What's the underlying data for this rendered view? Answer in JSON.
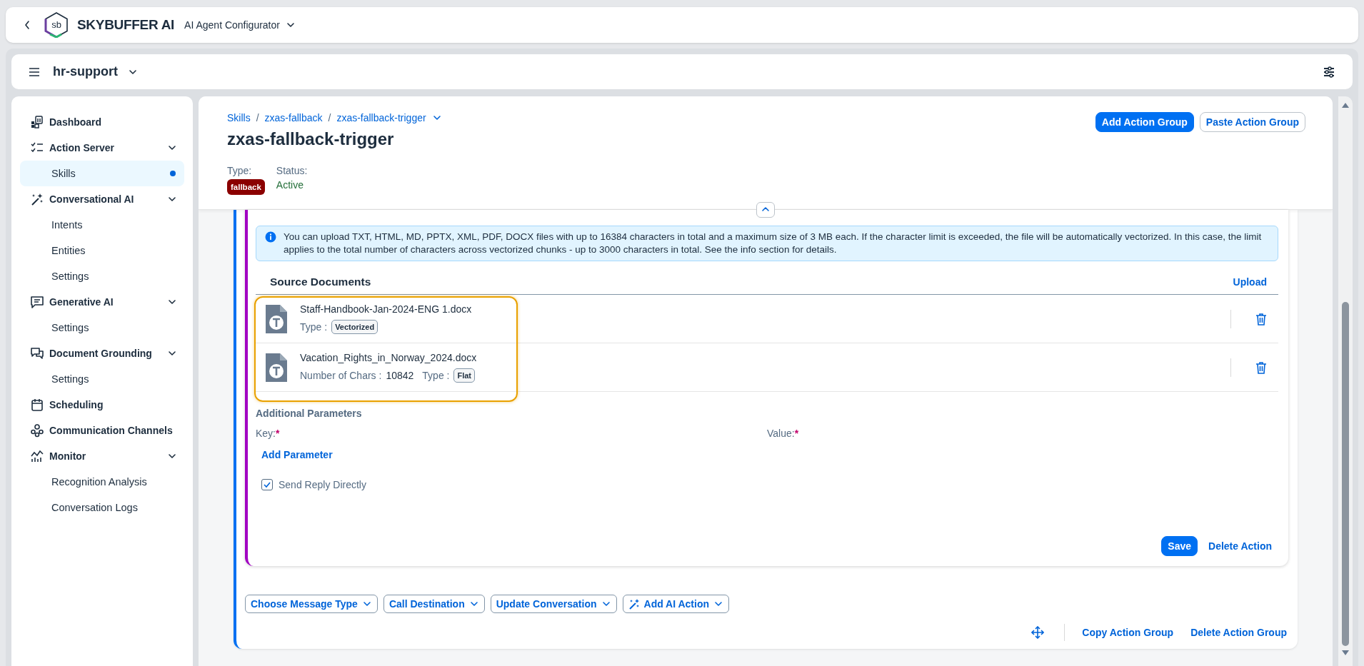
{
  "app_bar": {
    "logo_text": "sb",
    "brand": "SKYBUFFER AI",
    "app": "AI Agent Configurator"
  },
  "workspace": {
    "name": "hr-support"
  },
  "sidebar": {
    "items": [
      {
        "label": "Dashboard",
        "kind": "link",
        "selected": false
      },
      {
        "label": "Action Server",
        "kind": "group",
        "expanded": true,
        "children": [
          {
            "label": "Skills",
            "selected": true
          }
        ]
      },
      {
        "label": "Conversational AI",
        "kind": "group",
        "expanded": true,
        "children": [
          {
            "label": "Intents",
            "selected": false
          },
          {
            "label": "Entities",
            "selected": false
          },
          {
            "label": "Settings",
            "selected": false
          }
        ]
      },
      {
        "label": "Generative AI",
        "kind": "group",
        "expanded": true,
        "children": [
          {
            "label": "Settings",
            "selected": false
          }
        ]
      },
      {
        "label": "Document Grounding",
        "kind": "group",
        "expanded": true,
        "children": [
          {
            "label": "Settings",
            "selected": false
          }
        ]
      },
      {
        "label": "Scheduling",
        "kind": "link",
        "selected": false
      },
      {
        "label": "Communication Channels",
        "kind": "link",
        "selected": false
      },
      {
        "label": "Monitor",
        "kind": "group",
        "expanded": true,
        "children": [
          {
            "label": "Recognition Analysis",
            "selected": false
          },
          {
            "label": "Conversation Logs",
            "selected": false
          }
        ]
      }
    ]
  },
  "header": {
    "breadcrumb_separator": "/",
    "breadcrumb": [
      "Skills",
      "zxas-fallback",
      "zxas-fallback-trigger"
    ],
    "title": "zxas-fallback-trigger",
    "buttons": [
      {
        "label": "Add Action Group",
        "kind": "primary"
      },
      {
        "label": "Paste Action Group",
        "kind": "secondary"
      }
    ],
    "type": {
      "label": "Type:",
      "value": "fallback"
    },
    "status": {
      "label": "Status:",
      "value": "Active"
    }
  },
  "action": {
    "info": "You can upload TXT, HTML, MD, PPTX, XML, PDF, DOCX files with up to 16384 characters in total and a maximum size of 3 MB each. If the character limit is exceeded, the file will be automatically vectorized. In this case, the limit applies to the total number of characters across vectorized chunks - up to 3000 characters in total. See the info section for details.",
    "source_documents": {
      "title": "Source Documents",
      "upload": "Upload",
      "documents": [
        {
          "name": "Staff-Handbook-Jan-2024-ENG 1.docx",
          "details": [
            {
              "label": "Type :",
              "value": "Vectorized",
              "kind": "tag"
            }
          ]
        },
        {
          "name": "Vacation_Rights_in_Norway_2024.docx",
          "details": [
            {
              "label": "Number of Chars :",
              "value": "10842",
              "kind": "text"
            },
            {
              "label": "Type :",
              "value": "Flat",
              "kind": "tag"
            }
          ]
        }
      ]
    },
    "additional_parameters": {
      "title": "Additional Parameters",
      "key_label": "Key:",
      "value_label": "Value:",
      "required_mark": "*",
      "add": "Add Parameter"
    },
    "send_reply": {
      "label": "Send Reply Directly",
      "checked": true
    },
    "buttons": [
      {
        "label": "Save",
        "kind": "primary"
      },
      {
        "label": "Delete Action",
        "kind": "link"
      }
    ]
  },
  "menus": [
    {
      "label": "Choose Message Type",
      "kind": "plain"
    },
    {
      "label": "Call Destination",
      "kind": "plain"
    },
    {
      "label": "Update Conversation",
      "kind": "plain"
    },
    {
      "label": "Add AI Action",
      "kind": "ai"
    }
  ],
  "group_actions": [
    "Copy Action Group",
    "Delete Action Group"
  ]
}
